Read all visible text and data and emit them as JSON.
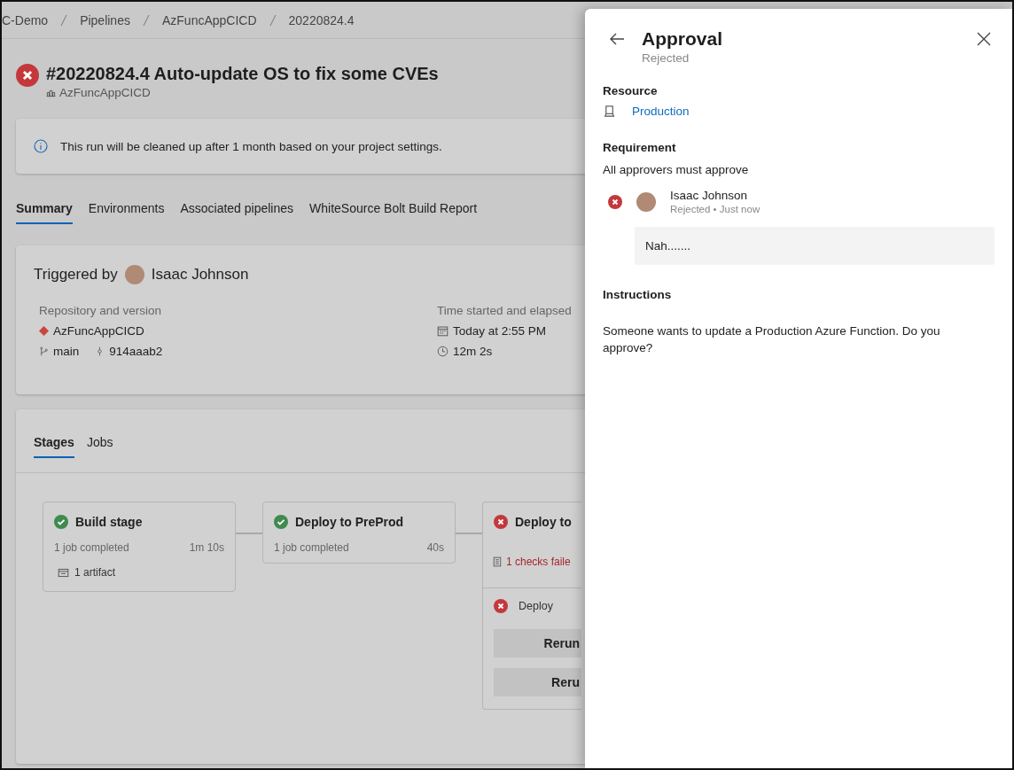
{
  "breadcrumb": [
    "C-Demo",
    "Pipelines",
    "AzFuncAppCICD",
    "20220824.4"
  ],
  "run": {
    "kind": "failed",
    "title": "#20220824.4 Auto-update OS to fix some CVEs",
    "pipeline": "AzFuncAppCICD"
  },
  "banner": "This run will be cleaned up after 1 month based on your project settings.",
  "tabs": [
    {
      "label": "Summary",
      "selected": true
    },
    {
      "label": "Environments",
      "selected": false
    },
    {
      "label": "Associated pipelines",
      "selected": false
    },
    {
      "label": "WhiteSource Bolt Build Report",
      "selected": false
    }
  ],
  "summary": {
    "triggered_label": "Triggered by",
    "user": "Isaac Johnson",
    "repo_heading": "Repository and version",
    "repo": "AzFuncAppCICD",
    "branch": "main",
    "commit": "914aaab2",
    "time_heading": "Time started and elapsed",
    "started": "Today at 2:55 PM",
    "elapsed": "12m 2s"
  },
  "stage_tabs": [
    {
      "label": "Stages",
      "selected": true
    },
    {
      "label": "Jobs",
      "selected": false
    }
  ],
  "stages": [
    {
      "name": "Build stage",
      "kind": "succeeded",
      "jobs": "1 job completed",
      "duration": "1m 10s",
      "artifacts": "1 artifact"
    },
    {
      "name": "Deploy to PreProd",
      "kind": "succeeded",
      "jobs": "1 job completed",
      "duration": "40s"
    },
    {
      "name": "Deploy to",
      "kind": "failed",
      "checks": "1 checks faile",
      "job": {
        "name": "Deploy",
        "kind": "failed"
      },
      "buttons": [
        "Rerun",
        "Reru"
      ]
    }
  ],
  "panel": {
    "title": "Approval",
    "subtitle": "Rejected",
    "resource_heading": "Resource",
    "resource": "Production",
    "requirement_heading": "Requirement",
    "requirement": "All approvers must approve",
    "approvers": [
      {
        "name": "Isaac Johnson",
        "kind": "rejected",
        "meta": "Rejected • Just now",
        "comment": "Nah......."
      }
    ],
    "instructions_heading": "Instructions",
    "instructions": "Someone wants to update a Production Azure Function. Do you approve?"
  }
}
